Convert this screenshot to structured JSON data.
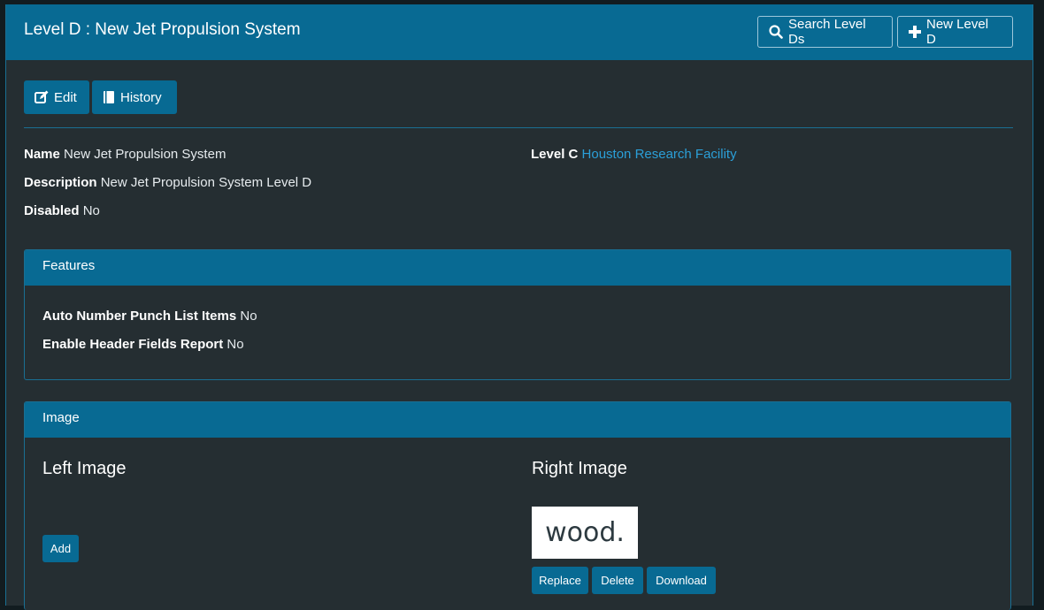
{
  "header": {
    "title": "Level D : New Jet Propulsion System",
    "search_label": "Search Level Ds",
    "new_label": "New Level D"
  },
  "actions": {
    "edit_label": "Edit",
    "history_label": "History"
  },
  "details": {
    "name_label": "Name",
    "name_value": "New Jet Propulsion System",
    "description_label": "Description",
    "description_value": "New Jet Propulsion System Level D",
    "disabled_label": "Disabled",
    "disabled_value": "No",
    "level_c_label": "Level C",
    "level_c_value": "Houston Research Facility"
  },
  "features": {
    "title": "Features",
    "auto_number_label": "Auto Number Punch List Items",
    "auto_number_value": "No",
    "enable_header_label": "Enable Header Fields Report",
    "enable_header_value": "No"
  },
  "image": {
    "title": "Image",
    "left_heading": "Left Image",
    "right_heading": "Right Image",
    "add_label": "Add",
    "replace_label": "Replace",
    "delete_label": "Delete",
    "download_label": "Download",
    "logo_text": "wood."
  },
  "icons": {
    "search": "search-icon",
    "new": "plus-icon",
    "edit": "edit-icon",
    "history": "book-icon"
  },
  "colors": {
    "primary": "#086a93",
    "background": "#252e32",
    "link": "#2b9fd8"
  }
}
